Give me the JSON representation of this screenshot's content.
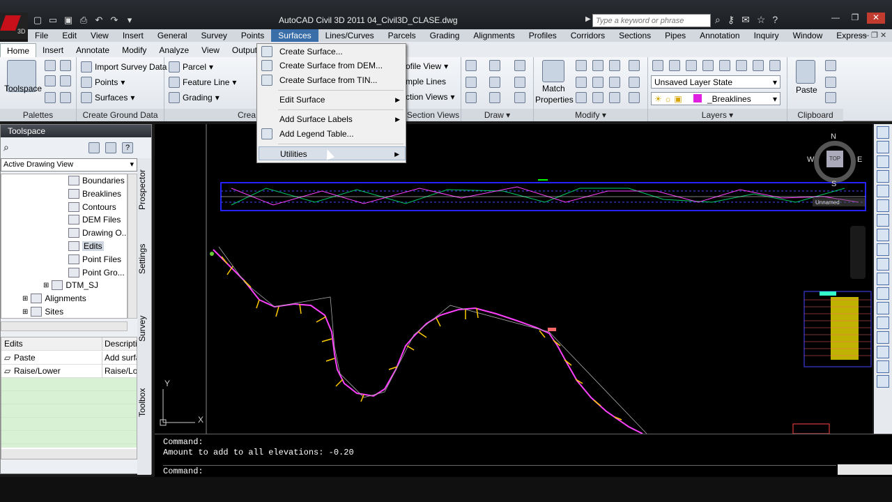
{
  "window": {
    "title": "AutoCAD Civil 3D 2011  04_Civil3D_CLASE.dwg",
    "search_placeholder": "Type a keyword or phrase",
    "logo_text": "3D"
  },
  "menubar": [
    "File",
    "Edit",
    "View",
    "Insert",
    "General",
    "Survey",
    "Points",
    "Surfaces",
    "Lines/Curves",
    "Parcels",
    "Grading",
    "Alignments",
    "Profiles",
    "Corridors",
    "Sections",
    "Pipes",
    "Annotation",
    "Inquiry",
    "Window",
    "Express"
  ],
  "ribbon_tabs": [
    "Home",
    "Insert",
    "Annotate",
    "Modify",
    "Analyze",
    "View",
    "Output"
  ],
  "ribbon": {
    "palettes": {
      "title": "Palettes",
      "toolspace": "Toolspace"
    },
    "ground": {
      "title": "Create Ground Data",
      "import": "Import Survey Data",
      "points": "Points",
      "surfaces": "Surfaces"
    },
    "design": {
      "title": "Crea",
      "parcel": "Parcel",
      "feature": "Feature Line",
      "grading": "Grading"
    },
    "profile": {
      "title": "Section Views",
      "views": "ofile View",
      "lines": "mple Lines",
      "sviews": "ction Views"
    },
    "draw": {
      "title": "Draw"
    },
    "modify": {
      "title": "Modify",
      "match": "Match",
      "props": "Properties"
    },
    "layers": {
      "title": "Layers",
      "state": "Unsaved Layer State",
      "layer": "_Breaklines"
    },
    "clipboard": {
      "title": "Clipboard",
      "paste": "Paste"
    }
  },
  "toolspace": {
    "title": "Toolspace",
    "view": "Active Drawing View",
    "tree": [
      "Boundaries",
      "Breaklines",
      "Contours",
      "DEM Files",
      "Drawing O...",
      "Edits",
      "Point Files",
      "Point Gro...",
      "DTM_SJ",
      "Alignments",
      "Sites"
    ],
    "vtabs": [
      "Prospector",
      "Settings",
      "Survey",
      "Toolbox"
    ],
    "grid": {
      "h1": "Edits",
      "h2": "Descriptio",
      "rows": [
        {
          "a": "Paste",
          "b": "Add surfa"
        },
        {
          "a": "Raise/Lower",
          "b": "Raise/Low"
        }
      ]
    }
  },
  "dropdown": {
    "items": [
      "Create Surface...",
      "Create Surface from DEM...",
      "Create Surface from TIN...",
      "Edit Surface",
      "Add Surface Labels",
      "Add Legend Table...",
      "Utilities"
    ]
  },
  "viewcube": {
    "n": "N",
    "s": "S",
    "e": "E",
    "w": "W",
    "top": "TOP",
    "label": "Unnamed"
  },
  "ucs": {
    "x": "X",
    "y": "Y"
  },
  "command": {
    "l1": "Command:",
    "l2": "Amount to add to all elevations: -0.20",
    "l3": "Command:"
  },
  "colors": {
    "accent": "#3a6ea8",
    "road": "#ff40ff",
    "layer": "#e020e0"
  }
}
